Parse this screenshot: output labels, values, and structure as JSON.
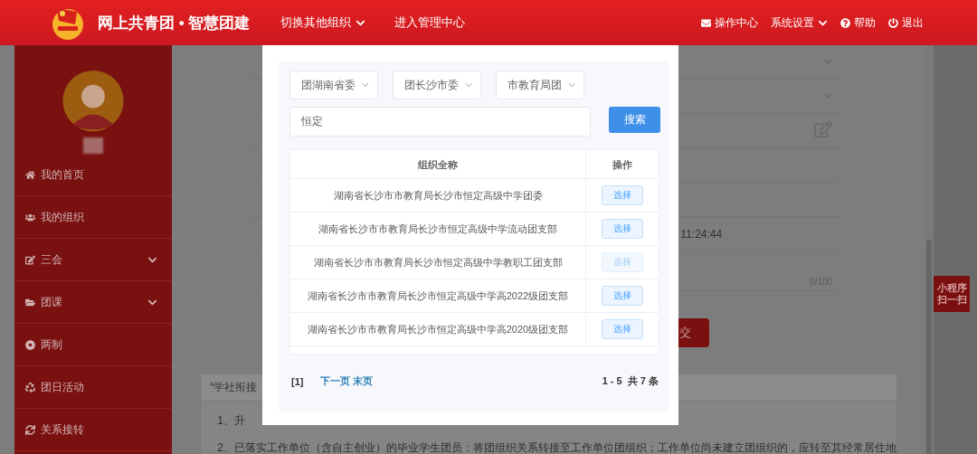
{
  "header": {
    "title": "网上共青团 • 智慧团建",
    "nav": [
      {
        "label": "切换其他组织",
        "dropdown": true
      },
      {
        "label": "进入管理中心",
        "dropdown": false
      }
    ],
    "actions": [
      {
        "label": "操作中心",
        "dropdown": false
      },
      {
        "label": "系统设置",
        "dropdown": true
      },
      {
        "label": "帮助",
        "dropdown": false
      },
      {
        "label": "退出",
        "dropdown": false
      }
    ]
  },
  "sidebar": {
    "items": [
      {
        "label": "我的首页",
        "kind": "link"
      },
      {
        "label": "我的组织",
        "kind": "link"
      },
      {
        "label": "三会",
        "kind": "group"
      },
      {
        "label": "团课",
        "kind": "group"
      },
      {
        "label": "两制",
        "kind": "link"
      },
      {
        "label": "团日活动",
        "kind": "link"
      },
      {
        "label": "关系接转",
        "kind": "link"
      }
    ]
  },
  "form": {
    "timestamp": "11:24:44",
    "counter": "0/100",
    "submit": "交"
  },
  "notice": {
    "title": "“学社衔接",
    "lines": [
      "1、升",
      "2、已落实工作单位（含自主创业）的毕业学生团员：将团组织关系转接至工作单位团组织；工作单位尚未建立团组织的，应转至其经常居住地"
    ]
  },
  "mini_program": {
    "lines": [
      "小程序",
      "扫一扫"
    ]
  },
  "dialog": {
    "filters": [
      "团湖南省委",
      "团长沙市委",
      "市教育局团"
    ],
    "search": {
      "value": "恒定"
    },
    "search_button": "搜索",
    "table": {
      "columns": [
        "组织全称",
        "操作"
      ],
      "rows": [
        {
          "name": "湖南省长沙市市教育局长沙市恒定高级中学团委",
          "action": "选择",
          "disabled": false
        },
        {
          "name": "湖南省长沙市市教育局长沙市恒定高级中学流动团支部",
          "action": "选择",
          "disabled": false
        },
        {
          "name": "湖南省长沙市市教育局长沙市恒定高级中学教职工团支部",
          "action": "选择",
          "disabled": true
        },
        {
          "name": "湖南省长沙市市教育局长沙市恒定高级中学高2022级团支部",
          "action": "选择",
          "disabled": false
        },
        {
          "name": "湖南省长沙市市教育局长沙市恒定高级中学高2020级团支部",
          "action": "选择",
          "disabled": false
        }
      ]
    },
    "pagination": {
      "current": "[1]",
      "links": [
        "下一页",
        "末页"
      ],
      "summary": "1 - 5  共 7 条"
    }
  }
}
